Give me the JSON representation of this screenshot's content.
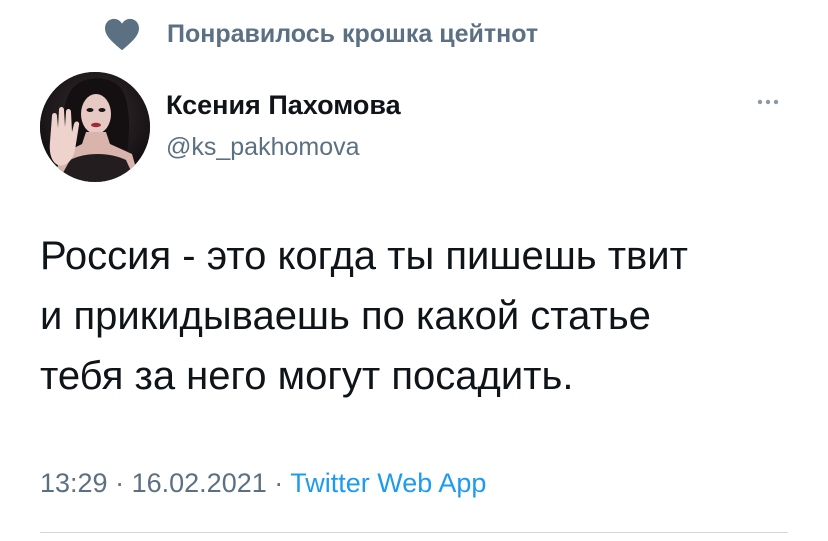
{
  "liked_banner": {
    "icon": "heart-icon",
    "text": "Понравилось крошка цейтнот"
  },
  "author": {
    "display_name": "Ксения Пахомова",
    "handle": "@ks_pakhomova",
    "avatar": "avatar-photo"
  },
  "more_menu": {
    "icon": "more-icon"
  },
  "tweet": {
    "lines": [
      "Россия - это когда ты пишешь твит",
      "и прикидываешь по какой статье",
      "тебя за него могут посадить."
    ]
  },
  "meta": {
    "time": "13:29",
    "separator": "·",
    "date": "16.02.2021",
    "source": "Twitter Web App"
  },
  "colors": {
    "text_primary": "#0f1419",
    "text_secondary": "#5b7083",
    "link": "#1d9bf0"
  }
}
